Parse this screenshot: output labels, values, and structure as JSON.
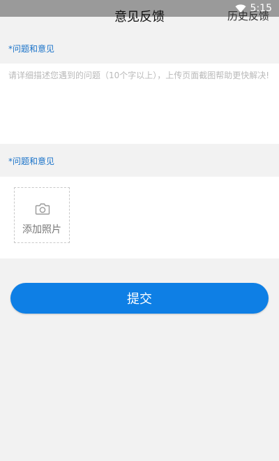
{
  "status_bar": {
    "time": "5:15",
    "wifi_icon": "wifi-icon"
  },
  "header": {
    "title": "意见反馈",
    "history_link": "历史反馈"
  },
  "feedback": {
    "section_label": "*问题和意见",
    "placeholder": "请详细描述您遇到的问题（10个字以上），上传页面截图帮助更快解决!",
    "value": ""
  },
  "photos": {
    "section_label": "*问题和意见",
    "add_photo_label": "添加照片",
    "camera_icon": "camera-icon"
  },
  "submit": {
    "label": "提交"
  },
  "colors": {
    "accent": "#0e7fe5",
    "label": "#1a73c9",
    "background": "#f2f2f2"
  }
}
